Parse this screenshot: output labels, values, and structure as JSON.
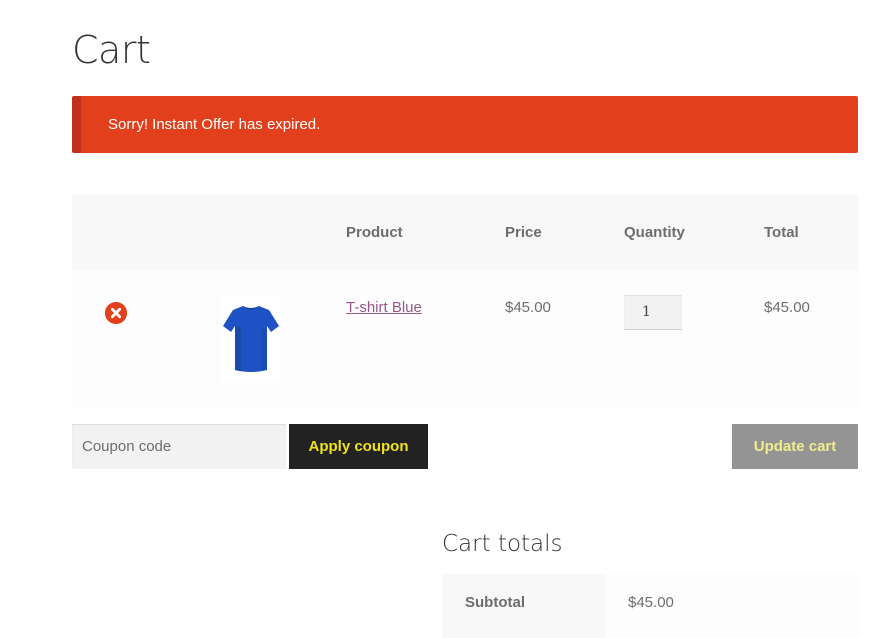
{
  "page": {
    "title": "Cart"
  },
  "notice": {
    "message": "Sorry! Instant Offer has expired.",
    "color": "#e2401c"
  },
  "cart_table": {
    "headers": [
      "Product",
      "Price",
      "Quantity",
      "Total"
    ],
    "items": [
      {
        "remove_icon": "remove-circle-icon",
        "thumbnail": "t-shirt-blue-thumbnail",
        "product": "T-shirt Blue",
        "price": "$45.00",
        "quantity": "1",
        "total": "$45.00"
      }
    ]
  },
  "coupon": {
    "placeholder": "Coupon code",
    "apply_label": "Apply coupon"
  },
  "update_label": "Update cart",
  "totals": {
    "title": "Cart totals",
    "subtotal_label": "Subtotal",
    "subtotal_value": "$45.00"
  },
  "colors": {
    "accent_link": "#96588a",
    "button_dark": "#222222",
    "button_text_yellow": "#f0e21a",
    "button_disabled": "#949494"
  }
}
